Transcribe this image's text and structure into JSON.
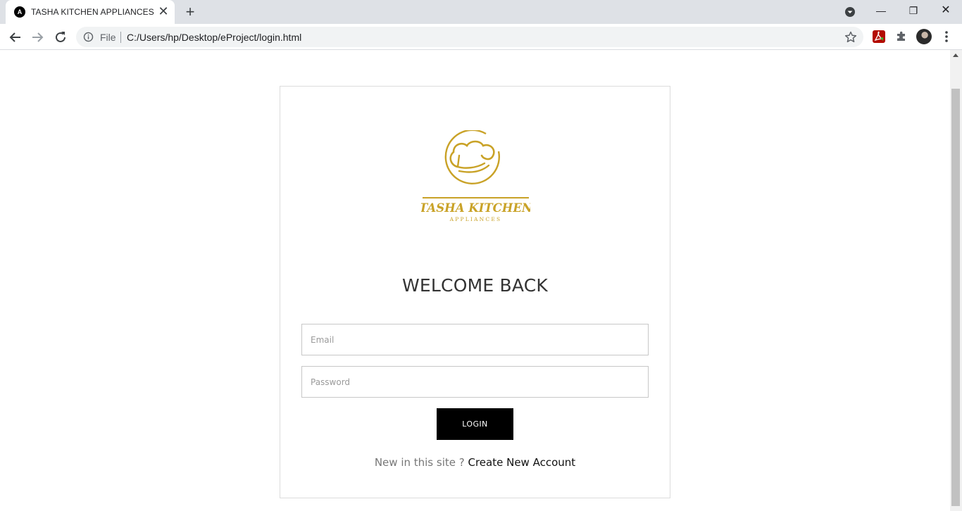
{
  "browser": {
    "tab_title": "TASHA KITCHEN APPLIANCES",
    "tab_favicon_letter": "A",
    "tab_close_glyph": "✕",
    "new_tab_glyph": "+",
    "scheme_label": "File",
    "url": "C:/Users/hp/Desktop/eProject/login.html"
  },
  "window_controls": {
    "minimize": "—",
    "restore": "❐",
    "close": "✕"
  },
  "icons": {
    "back": "arrow-left-icon",
    "forward": "arrow-right-icon",
    "reload": "reload-icon",
    "info": "info-icon",
    "bookmark": "star-icon",
    "extension_pdf": "acrobat-extension-icon",
    "extensions": "puzzle-icon",
    "menu": "kebab-menu-icon"
  },
  "logo": {
    "brand": "TASHA KITCHEN",
    "tagline": "APPLIANCES",
    "color": "#c9a227"
  },
  "login": {
    "heading": "WELCOME BACK",
    "email_placeholder": "Email",
    "email_value": "",
    "password_placeholder": "Password",
    "password_value": "",
    "button_label": "LOGIN",
    "signup_prompt": "New in this site ?",
    "signup_link": "Create New Account"
  }
}
